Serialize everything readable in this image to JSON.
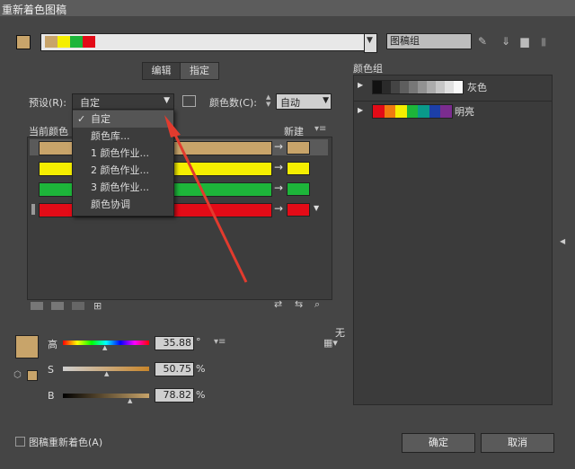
{
  "window": {
    "title": "重新着色图稿"
  },
  "top": {
    "chips": [
      "#c8a46a",
      "#f5ee00",
      "#1db53a",
      "#e30b17"
    ],
    "name_value": "图稿组"
  },
  "tabs": [
    {
      "label": "编辑"
    },
    {
      "label": "指定"
    }
  ],
  "preset": {
    "label": "预设(R):",
    "value": "自定"
  },
  "color_count": {
    "label": "颜色数(C):",
    "value": "自动"
  },
  "columns": {
    "current": "当前颜色",
    "new": "新建"
  },
  "rows": [
    {
      "current": "#c8a46a",
      "new": "#c8a46a"
    },
    {
      "current": "#f5ee00",
      "new": "#f5ee00"
    },
    {
      "current": "#1db53a",
      "new": "#1db53a"
    },
    {
      "current": "#e30b17",
      "new": "#e30b17"
    }
  ],
  "menu": {
    "items": [
      {
        "label": "自定",
        "checked": true
      },
      {
        "label": "颜色库..."
      },
      {
        "label": "1 颜色作业..."
      },
      {
        "label": "2 颜色作业..."
      },
      {
        "label": "3 颜色作业..."
      },
      {
        "label": "颜色协调"
      }
    ]
  },
  "sliders": {
    "h": {
      "label": "高",
      "value": "35.88",
      "unit": "°"
    },
    "s": {
      "label": "S",
      "value": "50.75",
      "unit": "%"
    },
    "b": {
      "label": "B",
      "value": "78.82",
      "unit": "%"
    }
  },
  "none_label": "无",
  "right_panel": {
    "title": "颜色组",
    "groups": [
      {
        "name": "灰色",
        "colors": [
          "#111111",
          "#2a2a2a",
          "#444444",
          "#5e5e5e",
          "#777777",
          "#929292",
          "#acacac",
          "#c6c6c6",
          "#e0e0e0",
          "#f8f8f8"
        ]
      },
      {
        "name": "明亮",
        "colors": [
          "#e30b17",
          "#f07a10",
          "#f5ee00",
          "#1db53a",
          "#0a9a8a",
          "#1c3fa8",
          "#7b2c8f"
        ]
      }
    ]
  },
  "footer": {
    "checkbox_label": "图稿重新着色(A)",
    "ok": "确定",
    "cancel": "取消"
  },
  "accent": "#e23b2e"
}
